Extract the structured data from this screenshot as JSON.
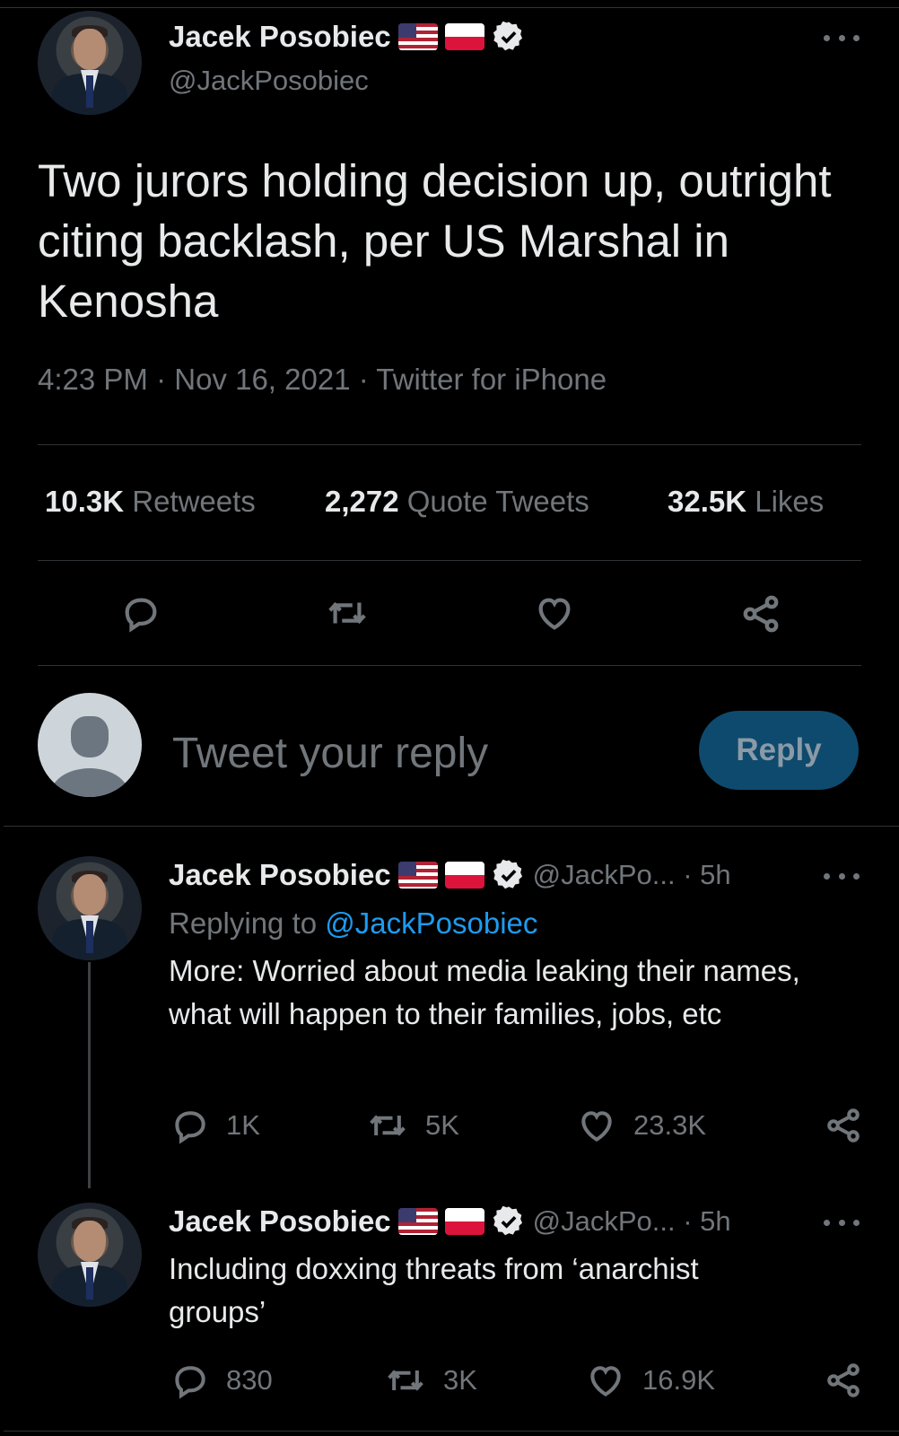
{
  "main_tweet": {
    "author_name": "Jacek Posobiec",
    "handle": "@JackPosobiec",
    "text": "Two jurors holding decision up, outright citing backlash, per US Marshal in Kenosha",
    "time": "4:23 PM",
    "date": "Nov 16, 2021",
    "source": "Twitter for iPhone",
    "stats": {
      "retweets_count": "10.3K",
      "retweets_label": "Retweets",
      "quotes_count": "2,272",
      "quotes_label": "Quote Tweets",
      "likes_count": "32.5K",
      "likes_label": "Likes"
    }
  },
  "composer": {
    "placeholder": "Tweet your reply",
    "button_label": "Reply"
  },
  "replies": [
    {
      "author_name": "Jacek Posobiec",
      "handle_time": "@JackPo... · 5h",
      "replying_prefix": "Replying to",
      "replying_to": "@JackPosobiec",
      "text": "More: Worried about media leaking their names, what will happen to their families, jobs, etc",
      "reply_count": "1K",
      "retweet_count": "5K",
      "like_count": "23.3K"
    },
    {
      "author_name": "Jacek Posobiec",
      "handle_time": "@JackPo... · 5h",
      "text": "Including doxxing threats from ‘anarchist groups’",
      "reply_count": "830",
      "retweet_count": "3K",
      "like_count": "16.9K"
    }
  ],
  "icons": {
    "flags": [
      "us-flag-icon",
      "poland-flag-icon"
    ],
    "verified": "verified-badge-icon",
    "actions": [
      "reply-icon",
      "retweet-icon",
      "like-icon",
      "share-icon"
    ],
    "more": "more-options-icon"
  },
  "colors": {
    "background": "#000000",
    "text": "#e7e9ea",
    "secondary": "#71767b",
    "accent": "#1d9bf0",
    "reply_button": "#0e4a6e",
    "divider": "#2f3336"
  }
}
